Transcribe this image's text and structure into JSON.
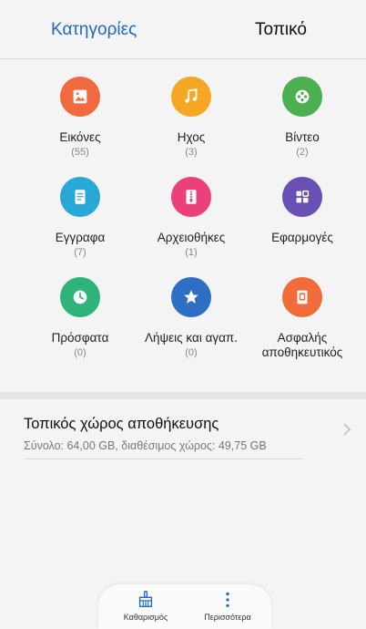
{
  "tabs": {
    "categories": "Κατηγορίες",
    "local": "Τοπικό"
  },
  "categories": [
    {
      "label": "Εικόνες",
      "count": "(55)",
      "color": "#f16a3f",
      "icon": "image-icon"
    },
    {
      "label": "Ηχος",
      "count": "(3)",
      "color": "#f5a623",
      "icon": "music-icon"
    },
    {
      "label": "Βίντεο",
      "count": "(2)",
      "color": "#4caf50",
      "icon": "video-icon"
    },
    {
      "label": "Εγγραφα",
      "count": "(7)",
      "color": "#29a8d8",
      "icon": "document-icon"
    },
    {
      "label": "Αρχειοθήκες",
      "count": "(1)",
      "color": "#ec407a",
      "icon": "archive-icon"
    },
    {
      "label": "Εφαρμογές",
      "count": "",
      "color": "#6a4fb4",
      "icon": "apps-icon"
    },
    {
      "label": "Πρόσφατα",
      "count": "(0)",
      "color": "#2db37b",
      "icon": "clock-icon"
    },
    {
      "label": "Λήψεις και αγαπ.",
      "count": "(0)",
      "color": "#2f6fc3",
      "icon": "star-icon"
    },
    {
      "label": "Ασφαλής αποθηκευτικός",
      "count": "",
      "color": "#f26b3a",
      "icon": "safe-icon"
    }
  ],
  "storage": {
    "title": "Τοπικός χώρος αποθήκευσης",
    "detail": "Σύνολο: 64,00 GB, διαθέσιμος χώρος: 49,75 GB"
  },
  "bottom": {
    "clean": "Καθαρισμός",
    "more": "Περισσότερα"
  },
  "accent": "#1f6bb8"
}
